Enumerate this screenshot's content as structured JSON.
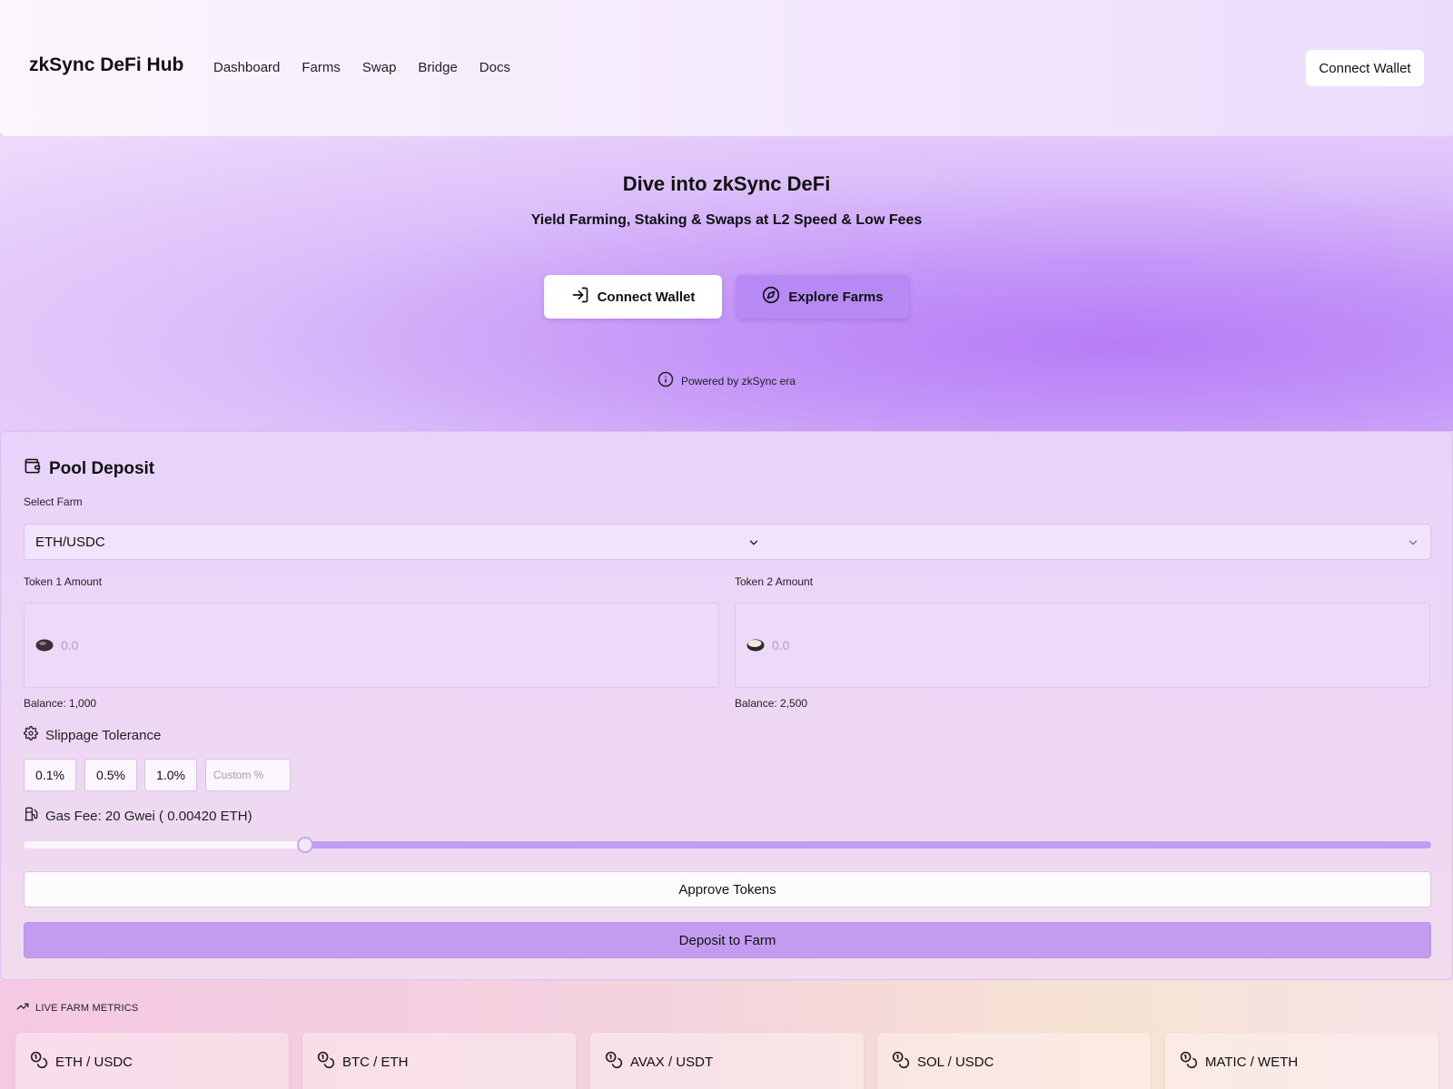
{
  "header": {
    "brand": "zkSync DeFi Hub",
    "nav": [
      "Dashboard",
      "Farms",
      "Swap",
      "Bridge",
      "Docs"
    ],
    "connect_label": "Connect Wallet"
  },
  "hero": {
    "title": "Dive into zkSync DeFi",
    "subtitle": "Yield Farming, Staking & Swaps at L2 Speed & Low Fees",
    "connect_label": "Connect Wallet",
    "explore_label": "Explore Farms",
    "powered": "Powered by zkSync era"
  },
  "deposit": {
    "title": "Pool Deposit",
    "select_label": "Select Farm",
    "selected_farm": "ETH/USDC",
    "token1_label": "Token 1 Amount",
    "token2_label": "Token 2 Amount",
    "token1_placeholder": "0.0",
    "token2_placeholder": "0.0",
    "token1_balance": "Balance: 1,000",
    "token2_balance": "Balance: 2,500",
    "slippage_title": "Slippage Tolerance",
    "slippage_options": [
      "0.1%",
      "0.5%",
      "1.0%"
    ],
    "custom_placeholder": "Custom %",
    "gas_text": "Gas Fee: 20 Gwei (  0.00420  ETH)",
    "gas_slider_fraction": 0.2,
    "approve_label": "Approve Tokens",
    "deposit_label": "Deposit to Farm"
  },
  "metrics": {
    "title": "LIVE FARM METRICS",
    "farms": [
      "ETH / USDC",
      "BTC / ETH",
      "AVAX / USDT",
      "SOL / USDC",
      "MATIC / WETH"
    ]
  },
  "colors": {
    "accent": "#b789f4",
    "deposit_button": "#c39cf0"
  },
  "icons": {
    "connect": "log-in-icon",
    "explore": "compass-icon",
    "info": "info-icon",
    "wallet": "wallet-icon",
    "chevron": "chevron-down-icon",
    "settings": "gear-icon",
    "gas": "fuel-icon",
    "trend": "trending-up-icon",
    "coins": "coins-icon"
  }
}
